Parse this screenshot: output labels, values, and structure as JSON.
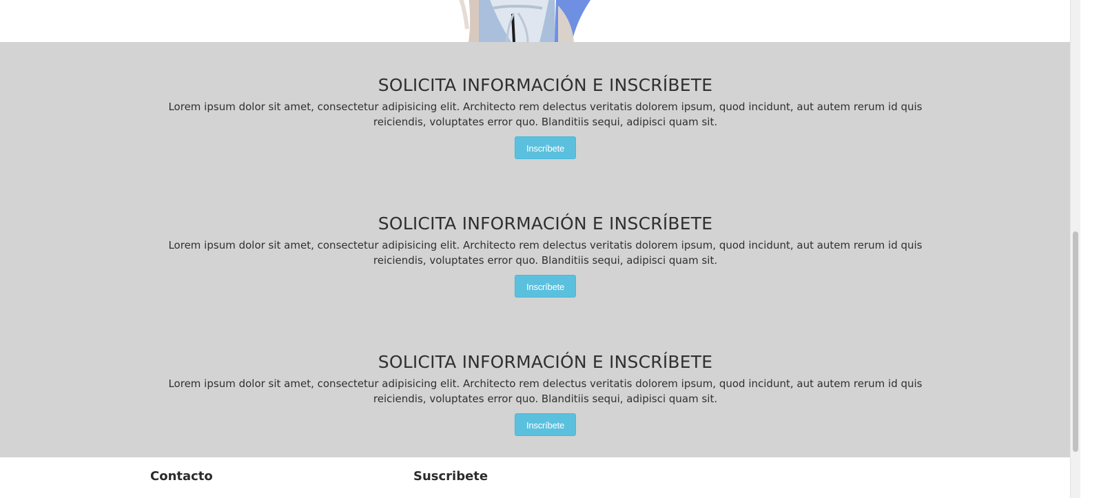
{
  "cta_sections": [
    {
      "title": "SOLICITA INFORMACIÓN E INSCRÍBETE",
      "body": "Lorem ipsum dolor sit amet, consectetur adipisicing elit. Architecto rem delectus veritatis dolorem ipsum, quod incidunt, aut autem rerum id quis reiciendis, voluptates error quo. Blanditiis sequi, adipisci quam sit.",
      "button_label": "Inscríbete"
    },
    {
      "title": "SOLICITA INFORMACIÓN E INSCRÍBETE",
      "body": "Lorem ipsum dolor sit amet, consectetur adipisicing elit. Architecto rem delectus veritatis dolorem ipsum, quod incidunt, aut autem rerum id quis reiciendis, voluptates error quo. Blanditiis sequi, adipisci quam sit.",
      "button_label": "Inscríbete"
    },
    {
      "title": "SOLICITA INFORMACIÓN E INSCRÍBETE",
      "body": "Lorem ipsum dolor sit amet, consectetur adipisicing elit. Architecto rem delectus veritatis dolorem ipsum, quod incidunt, aut autem rerum id quis reiciendis, voluptates error quo. Blanditiis sequi, adipisci quam sit.",
      "button_label": "Inscríbete"
    }
  ],
  "footer": {
    "contact_heading": "Contacto",
    "subscribe_heading": "Suscribete"
  },
  "colors": {
    "cta_band_background": "#d3d3d3",
    "button_background": "#5bc0de",
    "button_border": "#46b8da",
    "button_text": "#ffffff",
    "heading_text": "#2f2f2f"
  },
  "icons": {
    "hero_image": "hero-people-photo"
  }
}
